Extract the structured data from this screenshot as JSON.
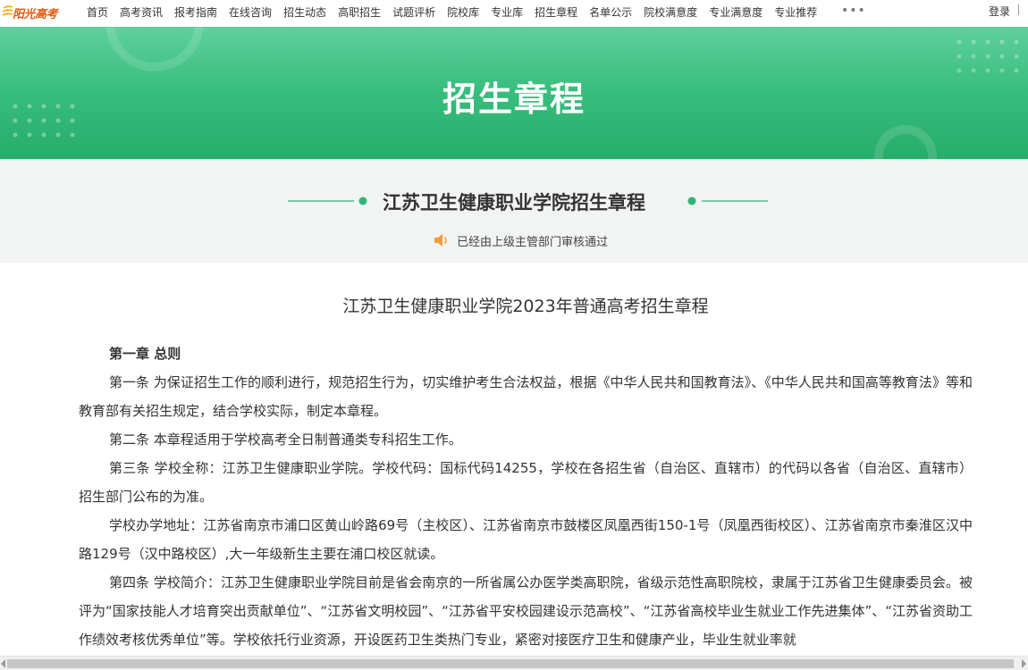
{
  "logo": {
    "text": "阳光高考",
    "icon": "sun-logo-icon"
  },
  "nav": {
    "items": [
      "首页",
      "高考资讯",
      "报考指南",
      "在线咨询",
      "招生动态",
      "高职招生",
      "试题评析",
      "院校库",
      "专业库",
      "招生章程",
      "名单公示",
      "院校满意度",
      "专业满意度",
      "专业推荐"
    ],
    "more": "•••",
    "login": "登录"
  },
  "banner": {
    "title": "招生章程"
  },
  "header": {
    "school_title": "江苏卫生健康职业学院招生章程",
    "audit_icon": "speaker-icon",
    "audit_text": "已经由上级主管部门审核通过"
  },
  "document": {
    "title": "江苏卫生健康职业学院2023年普通高考招生章程",
    "chapter1": "第一章  总则",
    "p1": "第一条 为保证招生工作的顺利进行，规范招生行为，切实维护考生合法权益，根据《中华人民共和国教育法》、《中华人民共和国高等教育法》等和教育部有关招生规定，结合学校实际，制定本章程。",
    "p2": "第二条 本章程适用于学校高考全日制普通类专科招生工作。",
    "p3": "第三条 学校全称：江苏卫生健康职业学院。学校代码：国标代码14255，学校在各招生省（自治区、直辖市）的代码以各省（自治区、直辖市）招生部门公布的为准。",
    "p4": "学校办学地址：江苏省南京市浦口区黄山岭路69号（主校区）、江苏省南京市鼓楼区凤凰西街150-1号（凤凰西街校区）、江苏省南京市秦淮区汉中路129号（汉中路校区）,大一年级新生主要在浦口校区就读。",
    "p5": "第四条 学校简介：江苏卫生健康职业学院目前是省会南京的一所省属公办医学类高职院，省级示范性高职院校，隶属于江苏省卫生健康委员会。被评为“国家技能人才培育突出贡献单位”、“江苏省文明校园”、“江苏省平安校园建设示范高校”、“江苏省高校毕业生就业工作先进集体”、“江苏省资助工作绩效考核优秀单位”等。学校依托行业资源，开设医药卫生类热门专业，紧密对接医疗卫生和健康产业，毕业生就业率就"
  },
  "colors": {
    "banner_green": "#37bd7c",
    "logo_orange": "#e8590c",
    "accent_green": "#2fb574"
  }
}
